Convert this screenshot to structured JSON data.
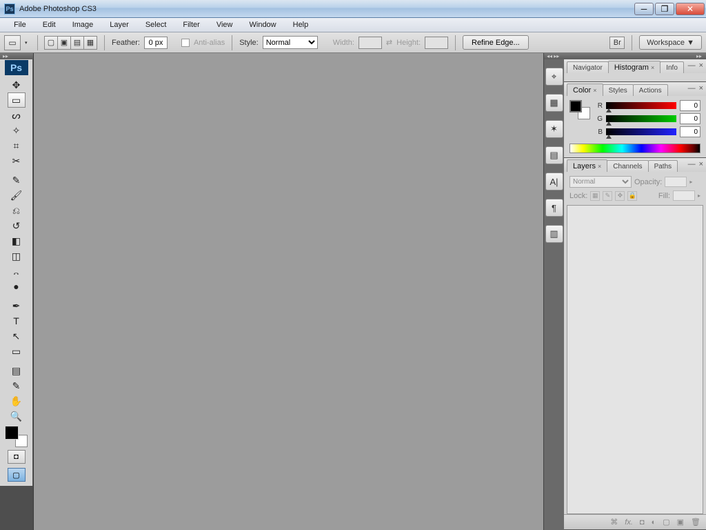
{
  "title": "Adobe Photoshop CS3",
  "menu": [
    "File",
    "Edit",
    "Image",
    "Layer",
    "Select",
    "Filter",
    "View",
    "Window",
    "Help"
  ],
  "options": {
    "feather_label": "Feather:",
    "feather_value": "0 px",
    "antialias_label": "Anti-alias",
    "style_label": "Style:",
    "style_value": "Normal",
    "width_label": "Width:",
    "height_label": "Height:",
    "refine_label": "Refine Edge...",
    "workspace_label": "Workspace ▼"
  },
  "tools": [
    {
      "name": "move-tool",
      "glyph": "✥"
    },
    {
      "name": "marquee-tool",
      "glyph": "▭",
      "selected": true
    },
    {
      "name": "lasso-tool",
      "glyph": "ᔕ"
    },
    {
      "name": "magic-wand-tool",
      "glyph": "✧"
    },
    {
      "name": "crop-tool",
      "glyph": "⌗"
    },
    {
      "name": "slice-tool",
      "glyph": "✂"
    },
    {
      "name": "spacer",
      "glyph": ""
    },
    {
      "name": "healing-brush-tool",
      "glyph": "✎"
    },
    {
      "name": "brush-tool",
      "glyph": "🖌"
    },
    {
      "name": "clone-stamp-tool",
      "glyph": "⎌"
    },
    {
      "name": "history-brush-tool",
      "glyph": "↺"
    },
    {
      "name": "eraser-tool",
      "glyph": "◧"
    },
    {
      "name": "gradient-tool",
      "glyph": "◫"
    },
    {
      "name": "blur-tool",
      "glyph": "᎔"
    },
    {
      "name": "dodge-tool",
      "glyph": "●"
    },
    {
      "name": "spacer",
      "glyph": ""
    },
    {
      "name": "pen-tool",
      "glyph": "✒"
    },
    {
      "name": "type-tool",
      "glyph": "T"
    },
    {
      "name": "path-selection-tool",
      "glyph": "↖"
    },
    {
      "name": "shape-tool",
      "glyph": "▭"
    },
    {
      "name": "spacer",
      "glyph": ""
    },
    {
      "name": "notes-tool",
      "glyph": "▤"
    },
    {
      "name": "eyedropper-tool",
      "glyph": "✎"
    },
    {
      "name": "hand-tool",
      "glyph": "✋"
    },
    {
      "name": "zoom-tool",
      "glyph": "🔍"
    }
  ],
  "dock_icons": [
    {
      "name": "navigator-dock-icon",
      "glyph": "⌖"
    },
    {
      "name": "swatches-dock-icon",
      "glyph": "▦"
    },
    {
      "name": "brushes-dock-icon",
      "glyph": "✶"
    },
    {
      "name": "layer-comps-dock-icon",
      "glyph": "▤"
    },
    {
      "name": "character-dock-icon",
      "glyph": "A|"
    },
    {
      "name": "paragraph-dock-icon",
      "glyph": "¶"
    },
    {
      "name": "actions-dock-icon",
      "glyph": "▥"
    }
  ],
  "nav_panel": {
    "tabs": [
      "Navigator",
      "Histogram",
      "Info"
    ],
    "active": 1
  },
  "color_panel": {
    "tabs": [
      "Color",
      "Styles",
      "Actions"
    ],
    "active": 0,
    "channels": [
      {
        "label": "R",
        "value": "0",
        "class": "r"
      },
      {
        "label": "G",
        "value": "0",
        "class": "g"
      },
      {
        "label": "B",
        "value": "0",
        "class": "b"
      }
    ]
  },
  "layers_panel": {
    "tabs": [
      "Layers",
      "Channels",
      "Paths"
    ],
    "active": 0,
    "blend_mode": "Normal",
    "opacity_label": "Opacity:",
    "lock_label": "Lock:",
    "fill_label": "Fill:"
  }
}
